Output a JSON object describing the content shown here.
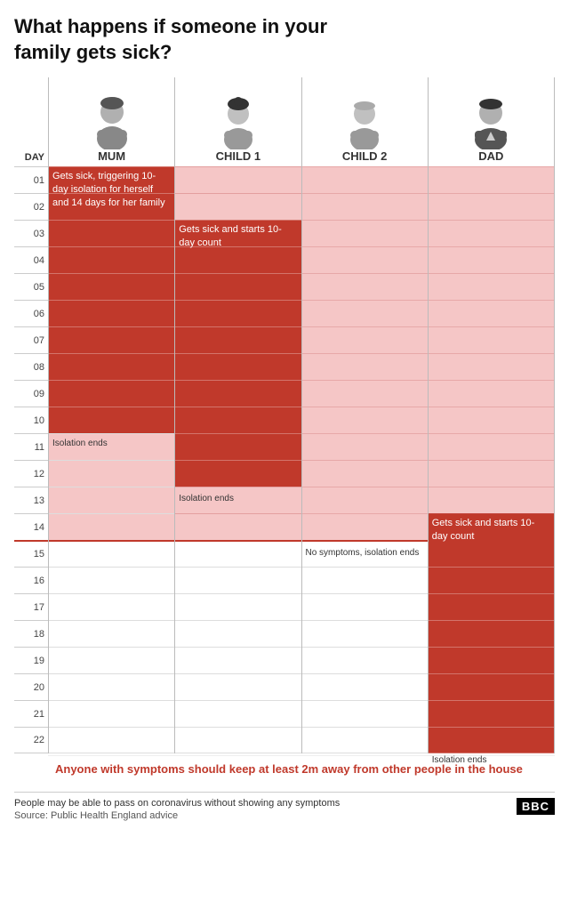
{
  "title": "What happens if someone in your family gets sick?",
  "columns": [
    {
      "id": "mum",
      "label": "MUM",
      "avatar": "female-light"
    },
    {
      "id": "child1",
      "label": "CHILD 1",
      "avatar": "female-dark"
    },
    {
      "id": "child2",
      "label": "CHILD 2",
      "avatar": "male-light"
    },
    {
      "id": "dad",
      "label": "DAD",
      "avatar": "male-dark"
    }
  ],
  "days": [
    "01",
    "02",
    "03",
    "04",
    "05",
    "06",
    "07",
    "08",
    "09",
    "10",
    "11",
    "12",
    "13",
    "14",
    "15",
    "16",
    "17",
    "18",
    "19",
    "20",
    "21",
    "22"
  ],
  "annotations": {
    "mum_text": "Gets sick, triggering 10-day isolation for herself and 14 days for her family",
    "mum_iso_end": "Isolation ends",
    "child1_text": "Gets sick and starts 10-day count",
    "child1_iso_end": "Isolation ends",
    "child2_iso_end": "No symptoms, isolation ends",
    "dad_text": "Gets sick and starts 10-day count",
    "dad_iso_end": "Isolation ends",
    "red_note": "Anyone with symptoms should keep at least 2m away from other people in the house"
  },
  "footer": {
    "note": "People may be able to pass on coronavirus without showing any symptoms",
    "source": "Source: Public Health England advice",
    "logo": "BBC"
  },
  "day_label_header": "DAY",
  "colors": {
    "dark_red": "#c0392b",
    "light_red": "#f5c6c6",
    "border": "#bbb"
  }
}
